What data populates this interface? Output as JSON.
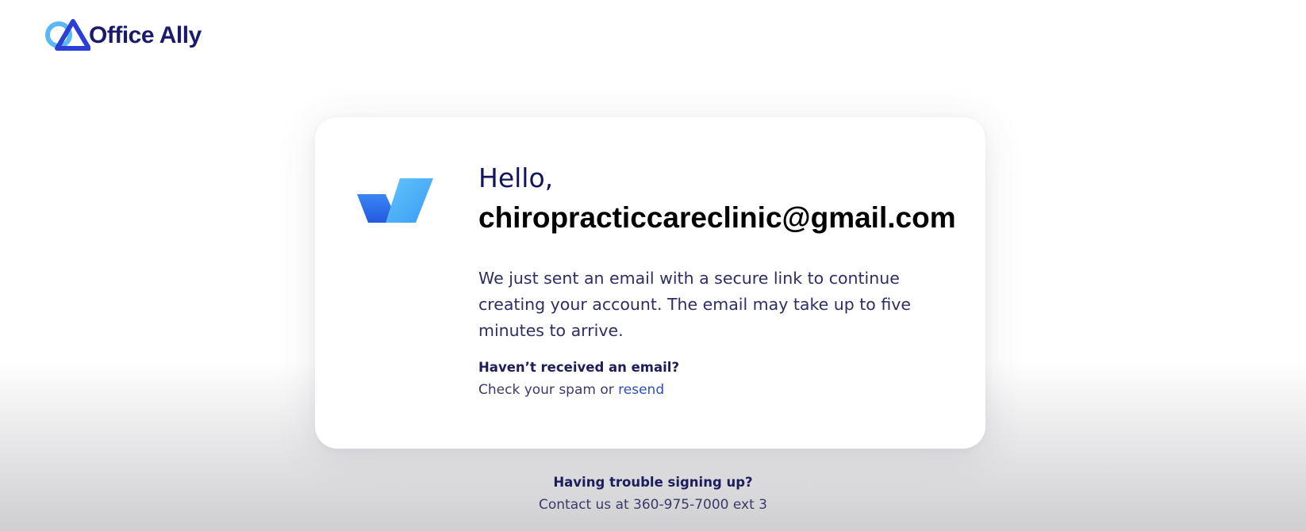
{
  "brand": {
    "name": "Office Ally",
    "logo_icon": "office-ally-logo-icon",
    "colors": {
      "navy": "#1b1b6b",
      "light_blue": "#5ab8f5",
      "blue": "#2b63e0"
    }
  },
  "card": {
    "icon": "check-icon",
    "greeting": "Hello,",
    "email": "chiropracticcareclinic@gmail.com",
    "message": "We just sent an email with a secure link to continue creating your account. The email may take up to five minutes to arrive.",
    "not_received_heading": "Haven’t received an email?",
    "spam_text": "Check your spam or ",
    "resend_label": "resend"
  },
  "footer": {
    "trouble_heading": "Having trouble signing up?",
    "contact_text": "Contact us at 360-975-7000 ext 3"
  }
}
